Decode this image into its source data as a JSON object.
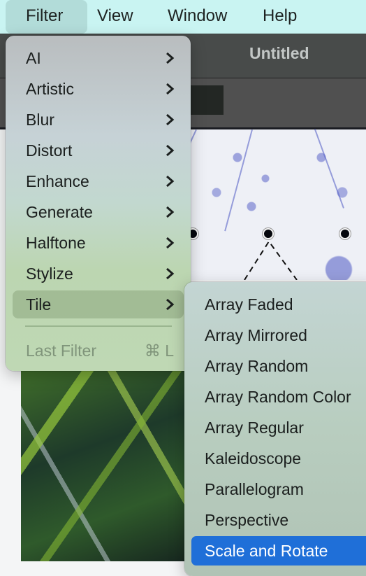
{
  "menubar": {
    "items": [
      {
        "label": "Filter",
        "active": true
      },
      {
        "label": "View"
      },
      {
        "label": "Window"
      },
      {
        "label": "Help"
      }
    ]
  },
  "window": {
    "title": "Untitled"
  },
  "filter_menu": {
    "items": [
      {
        "label": "AI",
        "submenu": true,
        "icon": "chevron-right-icon"
      },
      {
        "label": "Artistic",
        "submenu": true,
        "icon": "chevron-right-icon"
      },
      {
        "label": "Blur",
        "submenu": true,
        "icon": "chevron-right-icon"
      },
      {
        "label": "Distort",
        "submenu": true,
        "icon": "chevron-right-icon"
      },
      {
        "label": "Enhance",
        "submenu": true,
        "icon": "chevron-right-icon"
      },
      {
        "label": "Generate",
        "submenu": true,
        "icon": "chevron-right-icon"
      },
      {
        "label": "Halftone",
        "submenu": true,
        "icon": "chevron-right-icon"
      },
      {
        "label": "Stylize",
        "submenu": true,
        "icon": "chevron-right-icon"
      },
      {
        "label": "Tile",
        "submenu": true,
        "highlighted": true,
        "icon": "chevron-right-icon"
      }
    ],
    "last_filter": {
      "label": "Last Filter",
      "shortcut": "⌘ L",
      "disabled": true
    }
  },
  "tile_submenu": {
    "items": [
      {
        "label": "Array Faded"
      },
      {
        "label": "Array Mirrored"
      },
      {
        "label": "Array Random"
      },
      {
        "label": "Array Random Color"
      },
      {
        "label": "Array Regular"
      },
      {
        "label": "Kaleidoscope"
      },
      {
        "label": "Parallelogram"
      },
      {
        "label": "Perspective"
      },
      {
        "label": "Scale and Rotate",
        "selected": true
      }
    ]
  },
  "colors": {
    "menubar_bg": "#c9f4f2",
    "selection_blue": "#1f6fd8"
  }
}
